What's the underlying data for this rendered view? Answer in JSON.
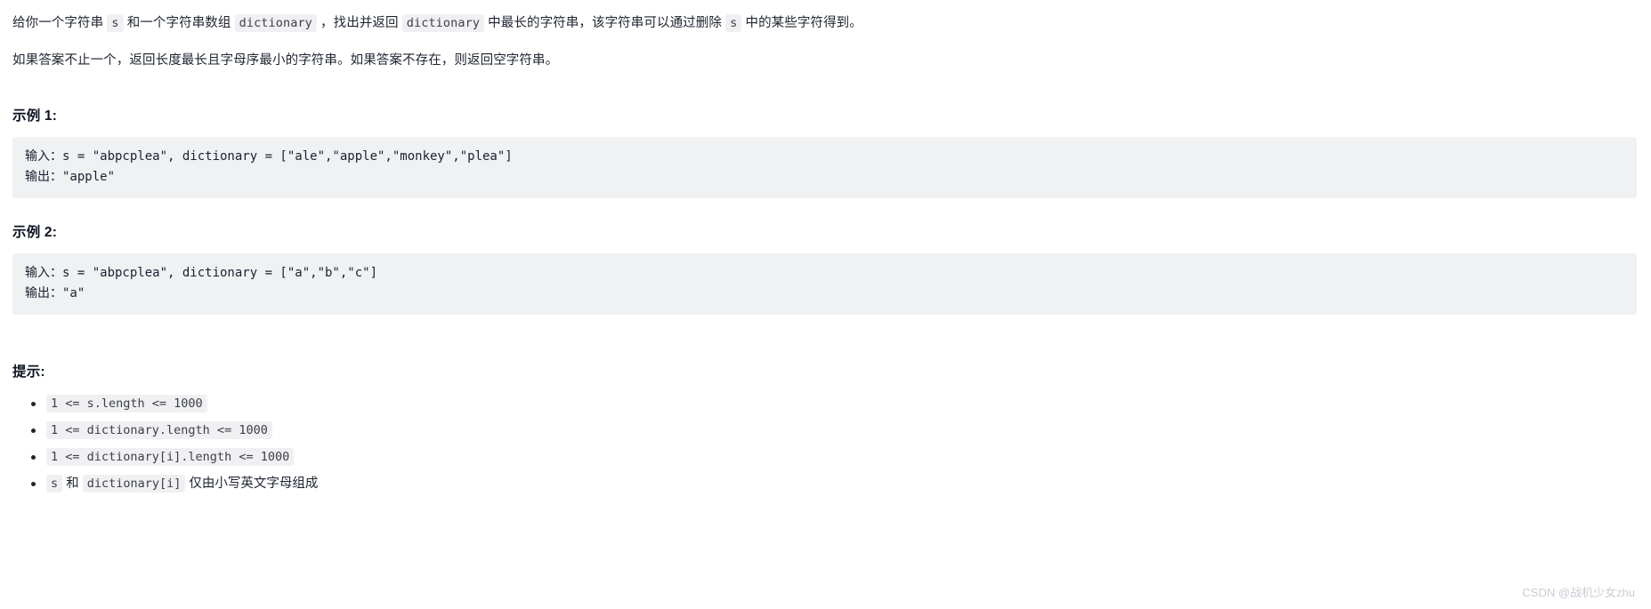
{
  "problem": {
    "description_paragraphs": [
      {
        "segments": [
          {
            "type": "text",
            "value": "给你一个字符串 "
          },
          {
            "type": "code",
            "value": "s"
          },
          {
            "type": "text",
            "value": " 和一个字符串数组 "
          },
          {
            "type": "code",
            "value": "dictionary"
          },
          {
            "type": "text",
            "value": " ，找出并返回 "
          },
          {
            "type": "code",
            "value": "dictionary"
          },
          {
            "type": "text",
            "value": " 中最长的字符串，该字符串可以通过删除 "
          },
          {
            "type": "code",
            "value": "s"
          },
          {
            "type": "text",
            "value": " 中的某些字符得到。"
          }
        ]
      },
      {
        "segments": [
          {
            "type": "text",
            "value": "如果答案不止一个，返回长度最长且字母序最小的字符串。如果答案不存在，则返回空字符串。"
          }
        ]
      }
    ],
    "examples": [
      {
        "heading": "示例 1:",
        "lines": [
          "输入：s = \"abpcplea\", dictionary = [\"ale\",\"apple\",\"monkey\",\"plea\"]",
          "输出：\"apple\""
        ]
      },
      {
        "heading": "示例 2:",
        "lines": [
          "输入：s = \"abpcplea\", dictionary = [\"a\",\"b\",\"c\"]",
          "输出：\"a\""
        ]
      }
    ],
    "hints": {
      "heading": "提示:",
      "items": [
        {
          "segments": [
            {
              "type": "code",
              "value": "1 <= s.length <= 1000"
            }
          ]
        },
        {
          "segments": [
            {
              "type": "code",
              "value": "1 <= dictionary.length <= 1000"
            }
          ]
        },
        {
          "segments": [
            {
              "type": "code",
              "value": "1 <= dictionary[i].length <= 1000"
            }
          ]
        },
        {
          "segments": [
            {
              "type": "code",
              "value": "s"
            },
            {
              "type": "text",
              "value": " 和 "
            },
            {
              "type": "code",
              "value": "dictionary[i]"
            },
            {
              "type": "text",
              "value": " 仅由小写英文字母组成"
            }
          ]
        }
      ]
    }
  },
  "watermark": {
    "text": "CSDN @战机少女zhu"
  },
  "colors": {
    "page_background": "#ffffff",
    "body_text": "#1f2430",
    "heading_text": "#0b1222",
    "inline_code_background": "#f0f0f2",
    "inline_code_text": "#3b3f4a",
    "code_block_background": "#f0f1f3",
    "code_block_text": "#1c2030",
    "watermark_text": "#c9ccd4"
  }
}
